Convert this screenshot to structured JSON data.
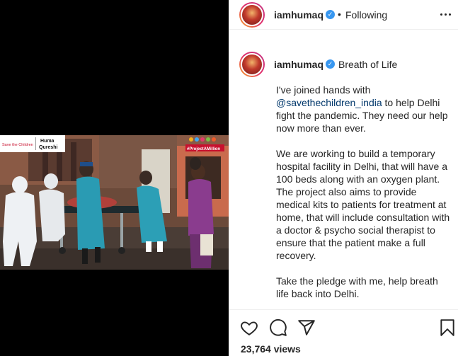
{
  "post": {
    "username": "iamhumaq",
    "header_separator": "•",
    "following_label": "Following",
    "caption_title": "Breath of Life",
    "caption_p1_before": "I've joined hands with",
    "caption_p1_mention": "@savethechildren_india",
    "caption_p1_after": "to help Delhi fight the pandemic. They need our help now more than ever.",
    "caption_p2": "We are working to build a temporary hospital facility in Delhi, that will have a 100 beds along with an oxygen plant. The project also aims to provide medical kits to patients for treatment at home, that will include consultation with a doctor & psycho social therapist to ensure that the patient make a full recovery.",
    "caption_p3": "Take the pledge with me, help breath life back into Delhi.",
    "views": "23,764 views"
  },
  "media": {
    "logo_left": "Save the Children",
    "logo_right_line1": "Huma",
    "logo_right_line2": "Qureshi",
    "hashtag": "#ProjectAMillion"
  },
  "icons": {
    "like": "heart-icon",
    "comment": "comment-icon",
    "share": "paper-plane-icon",
    "save": "bookmark-icon",
    "more": "more-options-icon",
    "verified": "verified-badge-icon"
  },
  "colors": {
    "verified": "#3897f0",
    "mention": "#00376b",
    "text": "#262626"
  }
}
